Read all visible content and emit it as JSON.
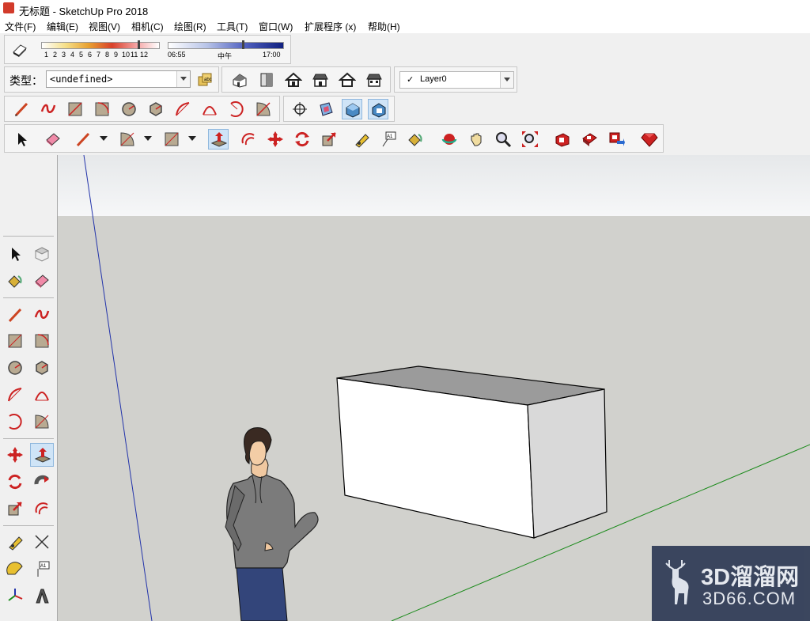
{
  "window": {
    "title": "无标题 - SketchUp Pro 2018"
  },
  "menu": [
    "文件(F)",
    "编辑(E)",
    "视图(V)",
    "相机(C)",
    "绘图(R)",
    "工具(T)",
    "窗口(W)",
    "扩展程序 (x)",
    "帮助(H)"
  ],
  "shadow": {
    "months": [
      "1",
      "2",
      "3",
      "4",
      "5",
      "6",
      "7",
      "8",
      "9",
      "10",
      "11",
      "12"
    ],
    "time_start": "06:55",
    "time_mid": "中午",
    "time_end": "17:00"
  },
  "type_combo": {
    "label": "类型：",
    "value": "<undefined>"
  },
  "layer": {
    "check": "✓",
    "value": "Layer0"
  },
  "watermark": {
    "brand_main": "3D溜溜网",
    "brand_sub": "3D66.COM"
  },
  "colors": {
    "sky": "#eef0f2",
    "ground": "#d1d1cd",
    "axis_red": "#d22",
    "axis_green": "#1a8a1a",
    "axis_blue": "#2233aa",
    "accent_red": "#cc2020",
    "active_btn": "#cfe4f7"
  }
}
